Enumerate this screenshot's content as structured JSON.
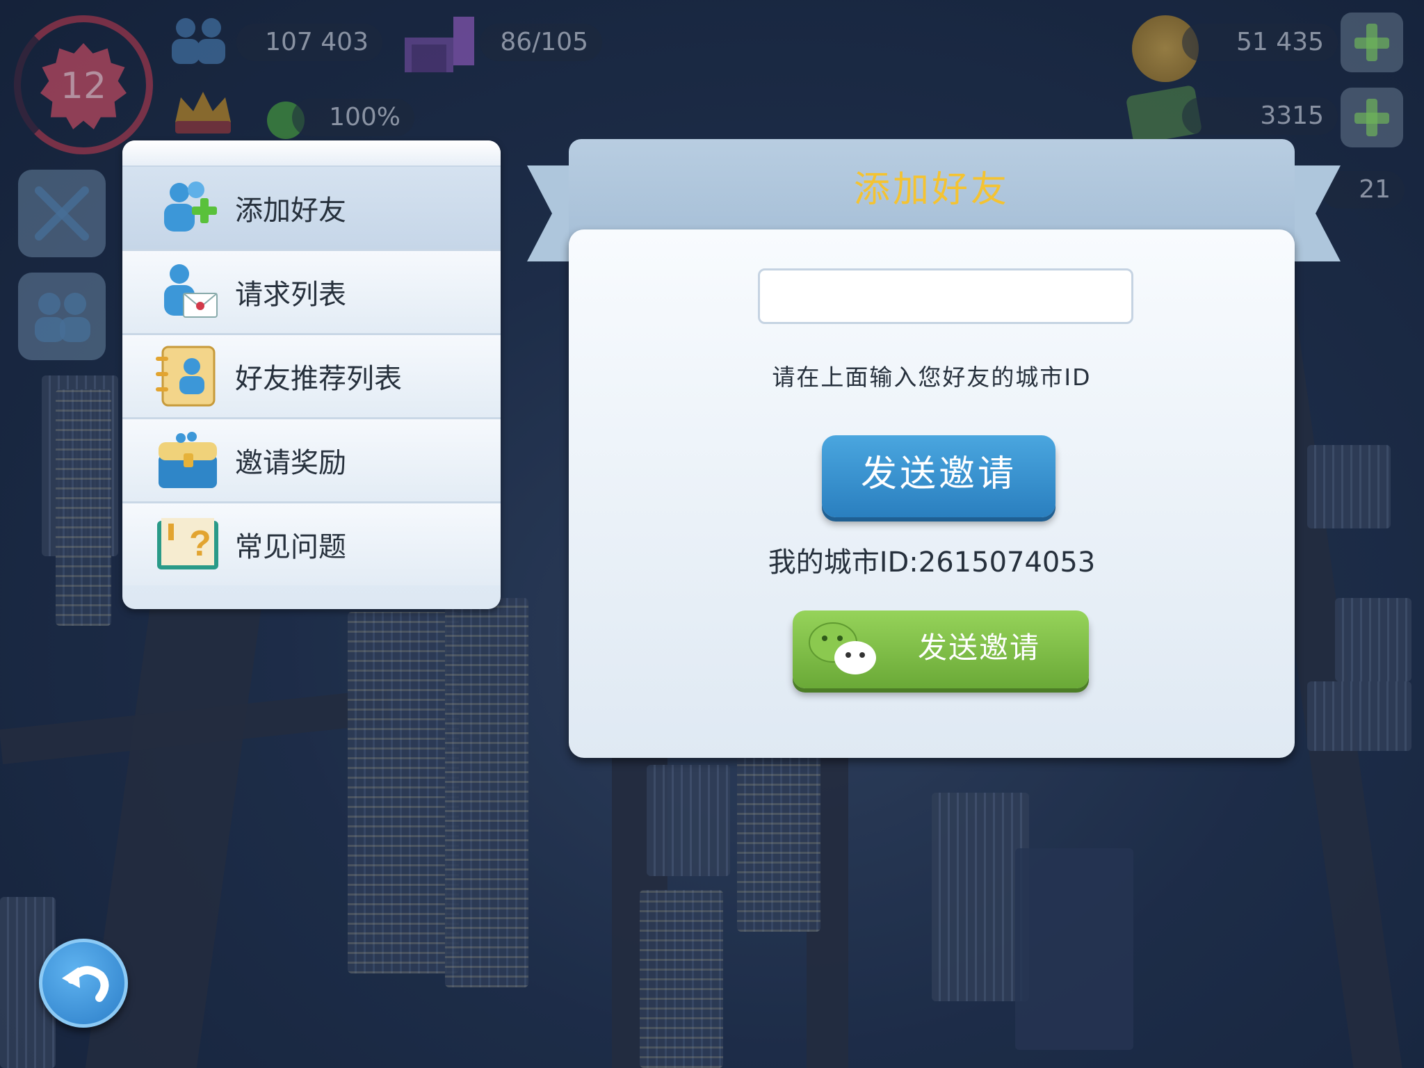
{
  "hud": {
    "level": "12",
    "population": "107 403",
    "storage": "86/105",
    "happiness": "100%",
    "simoleons": "51 435",
    "simcash": "3315",
    "golden_keys": "21"
  },
  "menu": {
    "items": [
      {
        "label": "添加好友"
      },
      {
        "label": "请求列表"
      },
      {
        "label": "好友推荐列表"
      },
      {
        "label": "邀请奖励"
      },
      {
        "label": "常见问题"
      }
    ]
  },
  "dialog": {
    "title": "添加好友",
    "input_value": "",
    "hint": "请在上面输入您好友的城市ID",
    "send_label": "发送邀请",
    "my_city_id": "我的城市ID:2615074053",
    "wechat_label": "发送邀请"
  }
}
